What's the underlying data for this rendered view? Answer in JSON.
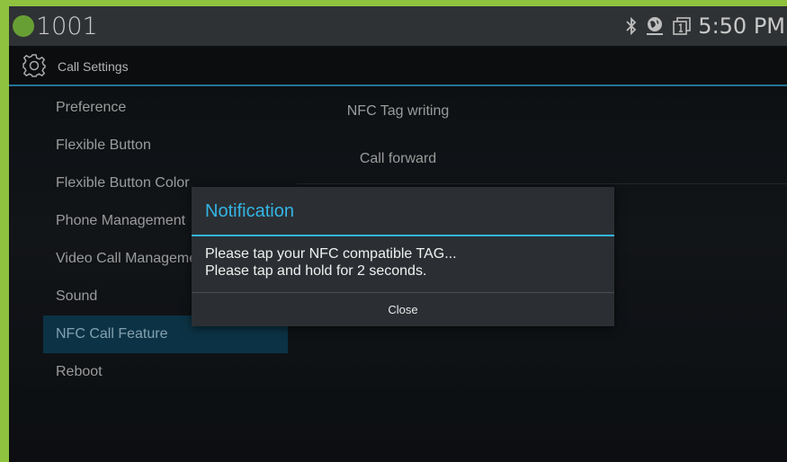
{
  "statusbar": {
    "extension": "1001",
    "time": "5:50 PM",
    "icons": [
      "presence-dot",
      "bluetooth-icon",
      "network-globe-icon",
      "sim-slot-icon"
    ],
    "presence_color": "#7fc241"
  },
  "actionbar": {
    "title": "Call Settings",
    "icon": "gear-icon"
  },
  "menu": {
    "items": [
      {
        "label": "Preference"
      },
      {
        "label": "Flexible Button"
      },
      {
        "label": "Flexible Button Color"
      },
      {
        "label": "Phone Management"
      },
      {
        "label": "Video Call Management"
      },
      {
        "label": "Sound"
      },
      {
        "label": "NFC Call Feature"
      },
      {
        "label": "Reboot"
      }
    ],
    "active_index": 6
  },
  "right_list": {
    "items": [
      {
        "label": "NFC Tag writing"
      },
      {
        "label": "Call forward"
      }
    ]
  },
  "dialog": {
    "title": "Notification",
    "line1": "Please tap your NFC compatible TAG...",
    "line2": "Please tap and hold for 2 seconds.",
    "close_label": "Close"
  },
  "colors": {
    "accent": "#33b5e5",
    "device_frame": "#8fc23f",
    "active_menu_bg": "#0f3f55"
  }
}
